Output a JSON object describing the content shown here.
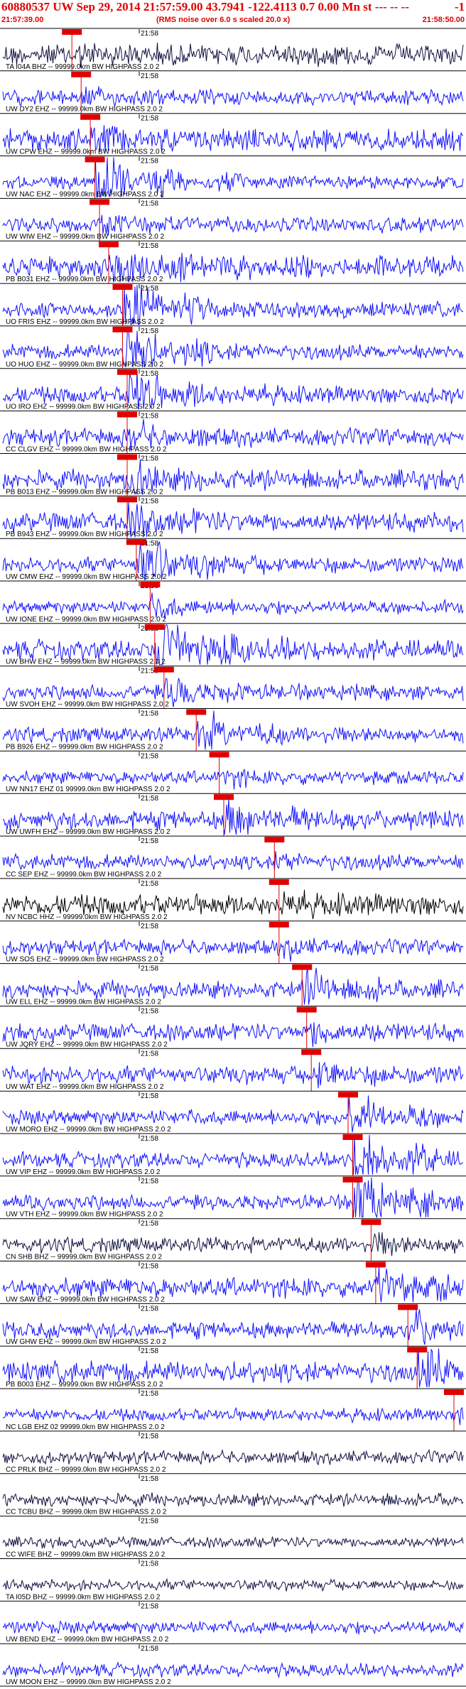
{
  "header": {
    "title_left": "60880537 UW Sep 29, 2014 21:57:59.00   43.7941 -122.4113  0.7 0.00 Mn st --- -- --",
    "title_right": "-1",
    "start_time": "21:57:39.00",
    "note": "(RMS noise over 6.0 s scaled 20.0 x)",
    "end_time": "21:58:50.00"
  },
  "chart_data": {
    "type": "line",
    "time_tick_label": "21:58",
    "colors": {
      "trace": "#1010ff",
      "trace_dark": "#101040",
      "trace_black": "#000000",
      "pick": "#e00000",
      "text": "#000000",
      "title": "#e00000"
    },
    "traces": [
      {
        "label": "TA I04A BHZ -- 99999.0km BW  HIGHPASS  2.0  2",
        "pick": 0.15,
        "amp": 0.5,
        "event": 0.2,
        "color": "trace_dark"
      },
      {
        "label": "UW DY2 EHZ -- 99999.0km BW  HIGHPASS  2.0  2",
        "pick": 0.17,
        "amp": 0.35,
        "event": 0.2,
        "color": "trace"
      },
      {
        "label": "UW CPW EHZ -- 99999.0km BW  HIGHPASS  2.0  2",
        "pick": 0.19,
        "amp": 0.5,
        "event": 0.4,
        "color": "trace"
      },
      {
        "label": "UW NAC EHZ -- 99999.0km BW  HIGHPASS  2.0  2",
        "pick": 0.2,
        "amp": 0.3,
        "event": 2.5,
        "color": "trace"
      },
      {
        "label": "UW WIW EHZ -- 99999.0km BW  HIGHPASS  2.0  2",
        "pick": 0.21,
        "amp": 0.35,
        "event": 0.3,
        "color": "trace"
      },
      {
        "label": "PB B031 EHZ -- 99999.0km BW  HIGHPASS  2.0  2",
        "pick": 0.23,
        "amp": 0.5,
        "event": 1.0,
        "color": "trace"
      },
      {
        "label": "UO FRIS EHZ -- 99999.0km BW  HIGHPASS  2.0  2",
        "pick": 0.26,
        "amp": 0.35,
        "event": 2.0,
        "color": "trace"
      },
      {
        "label": "UO HUO EHZ -- 99999.0km BW  HIGHPASS  2.0  2",
        "pick": 0.26,
        "amp": 0.35,
        "event": 2.0,
        "color": "trace"
      },
      {
        "label": "UO IRO EHZ -- 99999.0km BW  HIGHPASS  2.0  2",
        "pick": 0.27,
        "amp": 0.4,
        "event": 1.5,
        "color": "trace"
      },
      {
        "label": "CC CLGV EHZ -- 99999.0km BW  HIGHPASS  2.0  2",
        "pick": 0.27,
        "amp": 0.4,
        "event": 0.5,
        "color": "trace"
      },
      {
        "label": "PB B013 EHZ -- 99999.0km BW  HIGHPASS  2.0  2",
        "pick": 0.27,
        "amp": 0.45,
        "event": 0.8,
        "color": "trace"
      },
      {
        "label": "PB B943 EHZ -- 99999.0km BW  HIGHPASS  2.0  2",
        "pick": 0.27,
        "amp": 0.45,
        "event": 0.8,
        "color": "trace"
      },
      {
        "label": "UW CMW EHZ -- 99999.0km BW  HIGHPASS  2.0  2",
        "pick": 0.29,
        "amp": 0.35,
        "event": 1.8,
        "color": "trace"
      },
      {
        "label": "UW IONE EHZ -- 99999.0km BW  HIGHPASS  2.0  2",
        "pick": 0.32,
        "amp": 0.3,
        "event": 0.5,
        "color": "trace"
      },
      {
        "label": "UW BHW EHZ -- 99999.0km BW  HIGHPASS  2.0  2",
        "pick": 0.33,
        "amp": 0.45,
        "event": 2.5,
        "color": "trace"
      },
      {
        "label": "UW SVOH EHZ -- 99999.0km BW  HIGHPASS  2.0  2",
        "pick": 0.35,
        "amp": 0.35,
        "event": 0.8,
        "color": "trace"
      },
      {
        "label": "PB B926 EHZ -- 99999.0km BW  HIGHPASS  2.0  2",
        "pick": 0.42,
        "amp": 0.35,
        "event": 1.0,
        "color": "trace"
      },
      {
        "label": "UW NN17 EHZ 01 99999.0km BW  HIGHPASS  2.0  2",
        "pick": 0.47,
        "amp": 0.3,
        "event": 0.3,
        "color": "trace"
      },
      {
        "label": "UW UWFH EHZ -- 99999.0km BW  HIGHPASS  2.0  2",
        "pick": 0.48,
        "amp": 0.45,
        "event": 1.0,
        "color": "trace"
      },
      {
        "label": "CC SEP EHZ -- 99999.0km BW  HIGHPASS  2.0  2",
        "pick": 0.59,
        "amp": 0.35,
        "event": 0.3,
        "color": "trace"
      },
      {
        "label": "NV NCBC HHZ -- 99999.0km BW  HIGHPASS  2.0  2",
        "pick": 0.6,
        "amp": 0.5,
        "event": 0.3,
        "color": "trace_black"
      },
      {
        "label": "UW SOS EHZ -- 99999.0km BW  HIGHPASS  2.0  2",
        "pick": 0.6,
        "amp": 0.35,
        "event": 0.3,
        "color": "trace"
      },
      {
        "label": "UW ELL EHZ -- 99999.0km BW  HIGHPASS  2.0  2",
        "pick": 0.65,
        "amp": 0.4,
        "event": 1.0,
        "color": "trace"
      },
      {
        "label": "UW JQRY EHZ -- 99999.0km BW  HIGHPASS  2.0  2",
        "pick": 0.66,
        "amp": 0.4,
        "event": 0.6,
        "color": "trace"
      },
      {
        "label": "UW WAT EHZ -- 99999.0km BW  HIGHPASS  2.0  2",
        "pick": 0.67,
        "amp": 0.4,
        "event": 0.6,
        "color": "trace"
      },
      {
        "label": "UW MORO EHZ -- 99999.0km BW  HIGHPASS  2.0  2",
        "pick": 0.75,
        "amp": 0.35,
        "event": 1.2,
        "color": "trace"
      },
      {
        "label": "UW VIP EHZ -- 99999.0km BW  HIGHPASS  2.0  2",
        "pick": 0.76,
        "amp": 0.35,
        "event": 2.0,
        "color": "trace"
      },
      {
        "label": "UW VTH EHZ -- 99999.0km BW  HIGHPASS  2.0  2",
        "pick": 0.76,
        "amp": 0.35,
        "event": 2.0,
        "color": "trace"
      },
      {
        "label": "CN SHB BHZ -- 99999.0km BW  HIGHPASS  2.0  2",
        "pick": 0.8,
        "amp": 0.35,
        "event": 0.4,
        "color": "trace_dark"
      },
      {
        "label": "UW SAW EHZ -- 99999.0km BW  HIGHPASS  2.0  2",
        "pick": 0.81,
        "amp": 0.45,
        "event": 1.0,
        "color": "trace"
      },
      {
        "label": "UW GHW EHZ -- 99999.0km BW  HIGHPASS  2.0  2",
        "pick": 0.88,
        "amp": 0.4,
        "event": 0.9,
        "color": "trace"
      },
      {
        "label": "PB B003 EHZ -- 99999.0km BW  HIGHPASS  2.0  2",
        "pick": 0.9,
        "amp": 0.5,
        "event": 1.0,
        "color": "trace"
      },
      {
        "label": "NC LGB EHZ 02 99999.0km BW  HIGHPASS  2.0  2",
        "pick": 0.98,
        "amp": 0.3,
        "event": 0.3,
        "color": "trace"
      },
      {
        "label": "CC PRLK BHZ -- 99999.0km BW  HIGHPASS  2.0  2",
        "pick": null,
        "amp": 0.3,
        "event": 0,
        "color": "trace_dark"
      },
      {
        "label": "CC TCBU BHZ -- 99999.0km BW  HIGHPASS  2.0  2",
        "pick": null,
        "amp": 0.3,
        "event": 0,
        "color": "trace_dark"
      },
      {
        "label": "CC WIFE BHZ -- 99999.0km BW  HIGHPASS  2.0  2",
        "pick": null,
        "amp": 0.25,
        "event": 0,
        "color": "trace_dark"
      },
      {
        "label": "TA I05D BHZ -- 99999.0km BW  HIGHPASS  2.0  2",
        "pick": null,
        "amp": 0.25,
        "event": 0,
        "color": "trace_dark"
      },
      {
        "label": "UW BEND EHZ -- 99999.0km BW  HIGHPASS  2.0  2",
        "pick": null,
        "amp": 0.3,
        "event": 0,
        "color": "trace"
      },
      {
        "label": "UW MOON EHZ -- 99999.0km BW  HIGHPASS  2.0  2",
        "pick": null,
        "amp": 0.3,
        "event": 0,
        "color": "trace"
      }
    ]
  }
}
